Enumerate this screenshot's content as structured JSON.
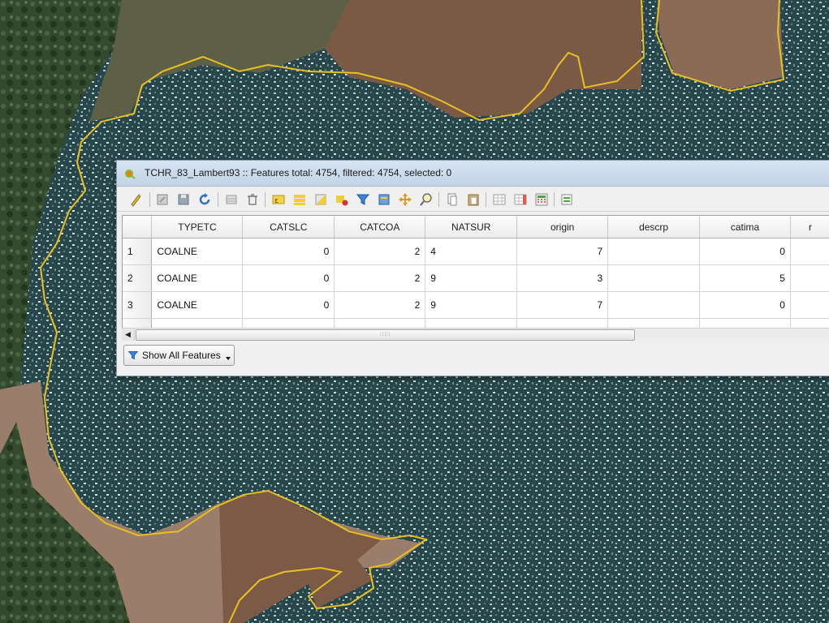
{
  "window": {
    "title": "TCHR_83_Lambert93 :: Features total: 4754, filtered: 4754, selected: 0",
    "app_icon": "qgis-icon"
  },
  "toolbar": {
    "buttons": [
      "toggle-editing-icon",
      "multi-edit-icon",
      "save-edits-icon",
      "reload-icon",
      "add-feature-icon",
      "delete-feature-icon",
      "select-by-expression-icon",
      "select-all-icon",
      "invert-selection-icon",
      "deselect-all-icon",
      "filter-icon",
      "move-selection-top-icon",
      "pan-to-selected-icon",
      "zoom-to-selected-icon",
      "copy-rows-icon",
      "paste-icon",
      "new-field-icon",
      "delete-field-icon",
      "field-calculator-icon",
      "conditional-formatting-icon"
    ]
  },
  "table": {
    "columns": [
      "TYPETC",
      "CATSLC",
      "CATCOA",
      "NATSUR",
      "origin",
      "descrp",
      "catima",
      "r"
    ],
    "rows": [
      {
        "id": "1",
        "cells": [
          "COALNE",
          "0",
          "2",
          "4",
          "7",
          "",
          "0",
          ""
        ]
      },
      {
        "id": "2",
        "cells": [
          "COALNE",
          "0",
          "2",
          "9",
          "3",
          "",
          "5",
          ""
        ]
      },
      {
        "id": "3",
        "cells": [
          "COALNE",
          "0",
          "2",
          "9",
          "7",
          "",
          "0",
          ""
        ]
      }
    ]
  },
  "filter_button": {
    "label": "Show All Features",
    "icon": "filter-icon"
  },
  "colors": {
    "coastline": "#e8c020",
    "titlebar": "#c9d8ea"
  }
}
